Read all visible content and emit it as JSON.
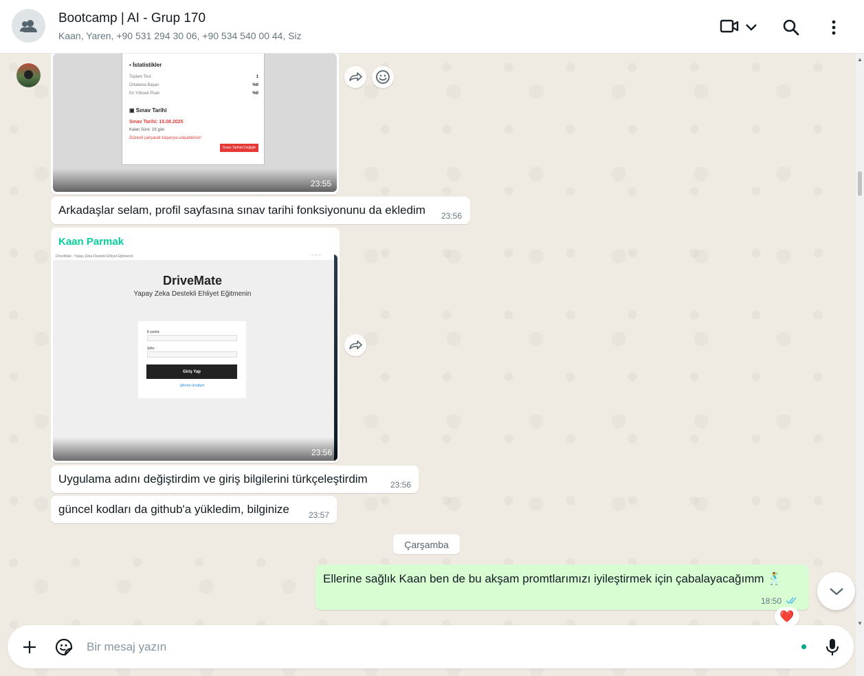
{
  "header": {
    "title": "Bootcamp | AI - Grup 170",
    "subtitle": "Kaan, Yaren, +90 531 294 30 06, +90 534 540 00 44, Siz"
  },
  "messages": [
    {
      "type": "image",
      "time": "23:55",
      "image_content": {
        "section1_title": "İstatistikler",
        "rows": [
          {
            "label": "Toplam Test",
            "value": "1"
          },
          {
            "label": "Ortalama Başarı",
            "value": "%0"
          },
          {
            "label": "En Yüksek Puan",
            "value": "%0"
          }
        ],
        "section2_title": "Sınav Tarihi",
        "exam_date": "Sınav Tarihi: 15.08.2025",
        "remaining": "Kalan Süre: 16 gün",
        "motivation": "Düzenli çalışarak başarıya ulaşabilirsin!",
        "button": "Sınav Tarihini Değiştir"
      }
    },
    {
      "type": "text",
      "text": "Arkadaşlar selam, profil sayfasına sınav tarihi fonksiyonunu da ekledim",
      "time": "23:56"
    },
    {
      "type": "image",
      "sender": "Kaan Parmak",
      "time": "23:56",
      "image_content": {
        "window_title": "DriveMate - Yapay Zeka Destekli Ehliyet Eğitmenin",
        "app_title": "DriveMate",
        "app_subtitle": "Yapay Zeka Destekli Ehliyet Eğitmenin",
        "email_label": "E-posta:",
        "password_label": "Şifre:",
        "login_button": "Giriş Yap",
        "forgot_link": "Şifremi Unuttum"
      }
    },
    {
      "type": "text",
      "text": "Uygulama adını değiştirdim ve giriş bilgilerini türkçeleştirdim",
      "time": "23:56"
    },
    {
      "type": "text",
      "text": "güncel kodları da github'a yükledim, bilginize",
      "time": "23:57"
    }
  ],
  "day_separator": "Çarşamba",
  "outgoing": {
    "text": "Ellerine sağlık Kaan ben de bu akşam promtlarımızı iyileştirmek için çabalayacağımm",
    "emoji": "🕺",
    "time": "18:50",
    "reaction": "❤️"
  },
  "composer": {
    "placeholder": "Bir mesaj yazın"
  },
  "colors": {
    "sender_name": "#06cf9c",
    "outgoing_bubble": "#d9fdd3",
    "read_ticks": "#53bdeb",
    "exam_red": "#e53935"
  },
  "icons": [
    "group-icon",
    "video-call-icon",
    "chevron-down-icon",
    "search-icon",
    "menu-icon",
    "forward-icon",
    "emoji-icon",
    "plus-icon",
    "sticker-icon",
    "mic-icon",
    "double-check-icon",
    "heart-icon"
  ]
}
